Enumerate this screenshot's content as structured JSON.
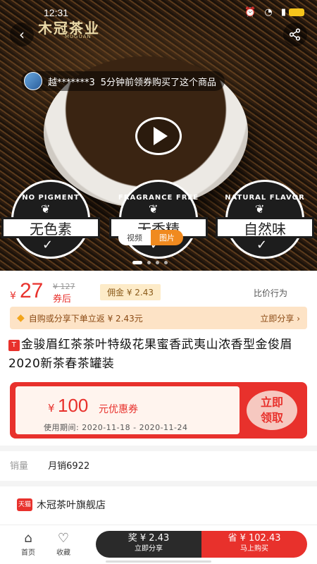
{
  "status": {
    "time": "12:31"
  },
  "brand": {
    "name": "木冠茶业",
    "sub": "MUGUAN"
  },
  "ticker": {
    "user": "越*******3",
    "message": "5分钟前领券购买了这个商品"
  },
  "badges": [
    {
      "arc": "NO PIGMENT",
      "label": "无色素"
    },
    {
      "arc": "FRAGRANCE FREE",
      "label": "无香精"
    },
    {
      "arc": "NATURAL FLAVOR",
      "label": "自然味"
    }
  ],
  "media": {
    "video": "视频",
    "photo": "图片"
  },
  "price": {
    "currency": "¥",
    "value": "27",
    "original": "¥ 127",
    "after_coupon": "券后",
    "commission": "佣金 ¥ 2.43",
    "compare": "比价行为"
  },
  "share_bar": {
    "text": "自购或分享下单立返 ¥ 2.43元",
    "action": "立即分享"
  },
  "product": {
    "tag": "T",
    "title": "金骏眉红茶茶叶特级花果蜜香武夷山浓香型金俊眉2020新茶春茶罐装"
  },
  "coupon": {
    "yen": "¥",
    "amount": "100",
    "label": "元优惠券",
    "dates": "使用期间: 2020-11-18 - 2020-11-24",
    "btn_line1": "立即",
    "btn_line2": "领取"
  },
  "sales": {
    "label": "销量",
    "value": "月销6922"
  },
  "shop": {
    "badge": "天猫",
    "name": "木冠茶叶旗舰店"
  },
  "bottom": {
    "home": "首页",
    "favorite": "收藏",
    "share_amount": "奖 ¥ 2.43",
    "share_label": "立即分享",
    "buy_amount": "省 ¥ 102.43",
    "buy_label": "马上购买"
  }
}
